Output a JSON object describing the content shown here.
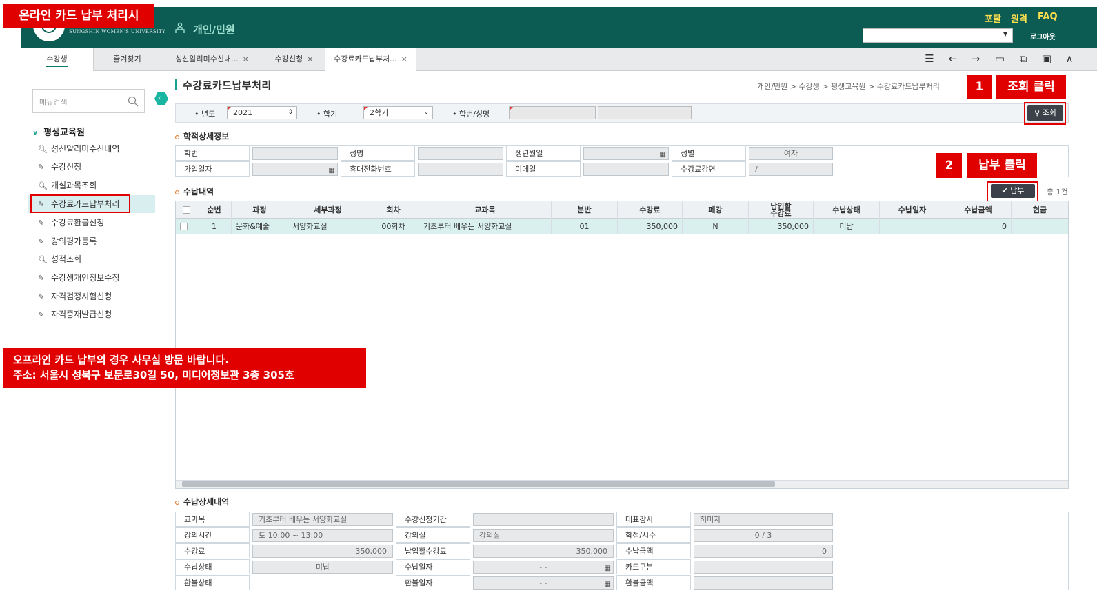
{
  "header": {
    "section_title": "개인/민원",
    "links": [
      "포탈",
      "원격",
      "FAQ"
    ],
    "logout": "로그아웃",
    "university": "SUNGSHIN WOMEN'S UNIVERSITY"
  },
  "overlays": {
    "title_banner": "온라인 카드 납부 처리시",
    "step1_num": "1",
    "step1_text": "조회 클릭",
    "step2_num": "2",
    "step2_text": "납부 클릭",
    "notice_line1": "오프라인 카드 납부의 경우 사무실 방문 바랍니다.",
    "notice_line2": "주소: 서울시 성북구 보문로30길 50, 미디어정보관 3층 305호"
  },
  "tabs": {
    "student": "수강생",
    "favorites": "즐겨찾기",
    "open": [
      {
        "label": "성신알리미수신내..."
      },
      {
        "label": "수강신청"
      },
      {
        "label": "수강료카드납부처..."
      }
    ],
    "close_glyph": "×"
  },
  "sidebar": {
    "search_placeholder": "메뉴검색",
    "root": "평생교육원",
    "items": [
      {
        "label": "성신알리미수신내역",
        "icon": "search-icon"
      },
      {
        "label": "수강신청",
        "icon": "edit-icon"
      },
      {
        "label": "개설과목조회",
        "icon": "search-icon"
      },
      {
        "label": "수강료카드납부처리",
        "icon": "edit-icon"
      },
      {
        "label": "수강료환불신청",
        "icon": "edit-icon"
      },
      {
        "label": "강의평가등록",
        "icon": "edit-icon"
      },
      {
        "label": "성적조회",
        "icon": "search-icon"
      },
      {
        "label": "수강생개인정보수정",
        "icon": "edit-icon"
      },
      {
        "label": "자격검정시험신청",
        "icon": "edit-icon"
      },
      {
        "label": "자격증재발급신청",
        "icon": "edit-icon"
      }
    ]
  },
  "main": {
    "heading": "수강료카드납부처리",
    "breadcrumb": "개인/민원 > 수강생 > 평생교육원 > 수강료카드납부처리",
    "search": {
      "year_label": "• 년도",
      "year_value": "2021",
      "term_label": "• 학기",
      "term_value": "2학기",
      "id_label": "• 학번/성명",
      "button": "조회"
    },
    "student_section": "학적상세정보",
    "student_fields": {
      "id": "학번",
      "name": "성명",
      "birth": "생년월일",
      "gender": "성별",
      "gender_value": "여자",
      "join": "가입일자",
      "phone": "휴대전화번호",
      "email": "이메일",
      "discount": "수강료감면",
      "discount_value": "/"
    },
    "payment_section": "수납내역",
    "pay_button": "납부",
    "total": "총 1건",
    "columns": [
      "순번",
      "과정",
      "세부과정",
      "회차",
      "교과목",
      "분반",
      "수강료",
      "폐강",
      "납입할 수강료",
      "수납상태",
      "수납일자",
      "수납금액",
      "현금"
    ],
    "rows": [
      [
        "1",
        "문화&예술",
        "서양화교실",
        "00회차",
        "기초부터 배우는 서양화교실",
        "01",
        "350,000",
        "N",
        "350,000",
        "미납",
        "",
        "0",
        ""
      ]
    ],
    "detail_section": "수납상세내역",
    "detail": {
      "subject": "교과목",
      "subject_value": "기초부터 배우는 서양화교실",
      "period": "수강신청기간",
      "period_value": "",
      "teacher": "대표강사",
      "teacher_value": "허미자",
      "time": "강의시간",
      "time_value": "토 10:00 ~ 13:00",
      "room": "강의실",
      "room_value": "강의실",
      "credit": "학점/시수",
      "credit_value": "0 / 3",
      "fee": "수강료",
      "fee_value": "350,000",
      "due": "납입할수강료",
      "due_value": "350,000",
      "paid_amt": "수납금액",
      "paid_amt_value": "0",
      "status": "수납상태",
      "status_value": "미납",
      "paid_date": "수납일자",
      "paid_date_value": "- -",
      "card": "카드구분",
      "card_value": "",
      "refund_status": "환불상태",
      "refund_status_value": "",
      "refund_date": "환불일자",
      "refund_date_value": "- -",
      "refund_amt": "환불금액",
      "refund_amt_value": ""
    }
  },
  "colors": {
    "header": "#0d5c54",
    "accent": "#18a090",
    "highlight": "#e00000"
  }
}
